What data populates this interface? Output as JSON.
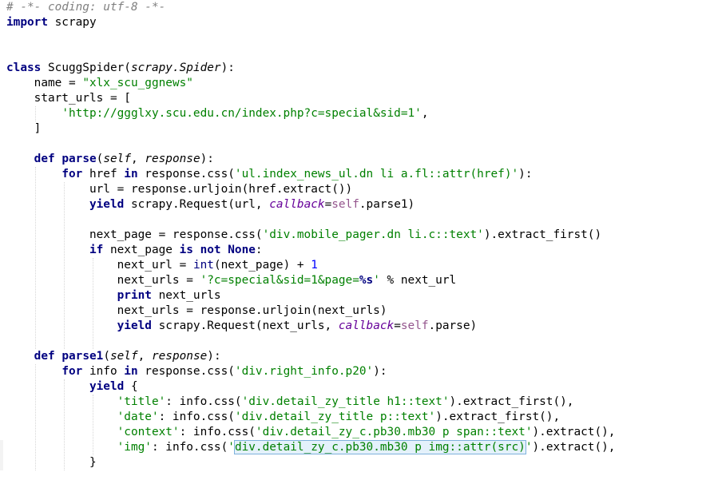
{
  "editor": {
    "language": "python",
    "colors": {
      "keyword": "#000080",
      "string": "#008000",
      "comment": "#808080",
      "number": "#0000ff",
      "self": "#94558d",
      "kwarg": "#660099",
      "selection_bg": "#e4f1fb",
      "selection_border": "#7fb2dc"
    },
    "lines": [
      [
        [
          "# -*- coding: utf-8 -*-",
          "comment"
        ]
      ],
      [
        [
          "import",
          "kw"
        ],
        [
          " scrapy",
          "plain"
        ]
      ],
      [],
      [],
      [
        [
          "class",
          "kw"
        ],
        [
          " ScuggSpider(",
          "plain"
        ],
        [
          "scrapy.Spider",
          "param"
        ],
        [
          "):",
          "plain"
        ]
      ],
      [
        [
          "    name = ",
          "plain"
        ],
        [
          "\"xlx_scu_ggnews\"",
          "str"
        ]
      ],
      [
        [
          "    start_urls = [",
          "plain"
        ]
      ],
      [
        [
          "        ",
          "plain"
        ],
        [
          "'http://ggglxy.scu.edu.cn/index.php?c=special&sid=1'",
          "str"
        ],
        [
          ",",
          "plain"
        ]
      ],
      [
        [
          "    ]",
          "plain"
        ]
      ],
      [],
      [
        [
          "    ",
          "plain"
        ],
        [
          "def",
          "kw"
        ],
        [
          " ",
          "plain"
        ],
        [
          "parse",
          "kw"
        ],
        [
          "(",
          "plain"
        ],
        [
          "self",
          "param"
        ],
        [
          ", ",
          "plain"
        ],
        [
          "response",
          "param"
        ],
        [
          "):",
          "plain"
        ]
      ],
      [
        [
          "        ",
          "plain"
        ],
        [
          "for",
          "kw"
        ],
        [
          " href ",
          "plain"
        ],
        [
          "in",
          "kw"
        ],
        [
          " response.css(",
          "plain"
        ],
        [
          "'ul.index_news_ul.dn li a.fl::attr(href)'",
          "str"
        ],
        [
          "):",
          "plain"
        ]
      ],
      [
        [
          "            url = response.urljoin(href.extract())",
          "plain"
        ]
      ],
      [
        [
          "            ",
          "plain"
        ],
        [
          "yield",
          "kw"
        ],
        [
          " scrapy.Request(url, ",
          "plain"
        ],
        [
          "callback",
          "kwarg"
        ],
        [
          "=",
          "plain"
        ],
        [
          "self",
          "self"
        ],
        [
          ".parse1)",
          "plain"
        ]
      ],
      [],
      [
        [
          "            next_page = response.css(",
          "plain"
        ],
        [
          "'div.mobile_pager.dn li.c::text'",
          "str"
        ],
        [
          ").extract_first()",
          "plain"
        ]
      ],
      [
        [
          "            ",
          "plain"
        ],
        [
          "if",
          "kw"
        ],
        [
          " next_page ",
          "plain"
        ],
        [
          "is not",
          "kw"
        ],
        [
          " ",
          "plain"
        ],
        [
          "None",
          "none"
        ],
        [
          ":",
          "plain"
        ]
      ],
      [
        [
          "                next_url = ",
          "plain"
        ],
        [
          "int",
          "builtin"
        ],
        [
          "(next_page) + ",
          "plain"
        ],
        [
          "1",
          "num"
        ]
      ],
      [
        [
          "                next_urls = ",
          "plain"
        ],
        [
          "'?c=special&sid=1&page=",
          "str"
        ],
        [
          "%s",
          "fmt"
        ],
        [
          "'",
          "str"
        ],
        [
          " % next_url",
          "plain"
        ]
      ],
      [
        [
          "                ",
          "plain"
        ],
        [
          "print",
          "kw"
        ],
        [
          " next_urls",
          "plain"
        ]
      ],
      [
        [
          "                next_urls = response.urljoin(next_urls)",
          "plain"
        ]
      ],
      [
        [
          "                ",
          "plain"
        ],
        [
          "yield",
          "kw"
        ],
        [
          " scrapy.Request(next_urls, ",
          "plain"
        ],
        [
          "callback",
          "kwarg"
        ],
        [
          "=",
          "plain"
        ],
        [
          "self",
          "self"
        ],
        [
          ".parse)",
          "plain"
        ]
      ],
      [],
      [
        [
          "    ",
          "plain"
        ],
        [
          "def",
          "kw"
        ],
        [
          " ",
          "plain"
        ],
        [
          "parse1",
          "kw"
        ],
        [
          "(",
          "plain"
        ],
        [
          "self",
          "param"
        ],
        [
          ", ",
          "plain"
        ],
        [
          "response",
          "param"
        ],
        [
          "):",
          "plain"
        ]
      ],
      [
        [
          "        ",
          "plain"
        ],
        [
          "for",
          "kw"
        ],
        [
          " info ",
          "plain"
        ],
        [
          "in",
          "kw"
        ],
        [
          " response.css(",
          "plain"
        ],
        [
          "'div.right_info.p20'",
          "str"
        ],
        [
          "):",
          "plain"
        ]
      ],
      [
        [
          "            ",
          "plain"
        ],
        [
          "yield",
          "kw"
        ],
        [
          " {",
          "plain"
        ]
      ],
      [
        [
          "                ",
          "plain"
        ],
        [
          "'title'",
          "str"
        ],
        [
          ": info.css(",
          "plain"
        ],
        [
          "'div.detail_zy_title h1::text'",
          "str"
        ],
        [
          ").extract_first(),",
          "plain"
        ]
      ],
      [
        [
          "                ",
          "plain"
        ],
        [
          "'date'",
          "str"
        ],
        [
          ": info.css(",
          "plain"
        ],
        [
          "'div.detail_zy_title p::text'",
          "str"
        ],
        [
          ").extract_first(),",
          "plain"
        ]
      ],
      [
        [
          "                ",
          "plain"
        ],
        [
          "'context'",
          "str"
        ],
        [
          ": info.css(",
          "plain"
        ],
        [
          "'div.detail_zy_c.pb30.mb30 p span::text'",
          "str"
        ],
        [
          ").extract(),",
          "plain"
        ]
      ],
      [
        [
          "                ",
          "plain"
        ],
        [
          "'img'",
          "str"
        ],
        [
          ": info.css(",
          "plain"
        ],
        [
          "'",
          "str"
        ],
        [
          "div.detail_zy_c.pb30.mb30 p img::attr(src)",
          "hl"
        ],
        [
          "'",
          "str"
        ],
        [
          ").extract(),",
          "plain"
        ]
      ],
      [
        [
          "            }",
          "plain"
        ]
      ]
    ]
  }
}
